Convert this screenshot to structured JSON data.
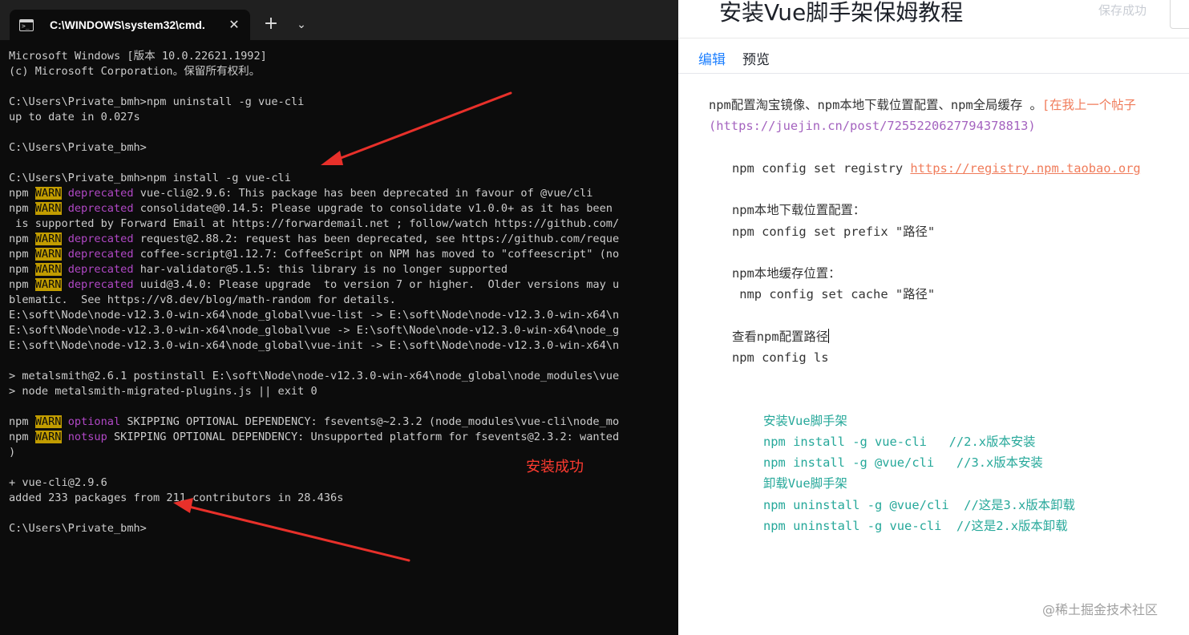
{
  "terminal": {
    "tab_title": "C:\\WINDOWS\\system32\\cmd.",
    "close_glyph": "✕",
    "new_tab_glyph": "+",
    "dropdown_glyph": "⌄",
    "lines": [
      [
        {
          "t": "Microsoft Windows [版本 10.0.22621.1992]"
        }
      ],
      [
        {
          "t": "(c) Microsoft Corporation。保留所有权利。"
        }
      ],
      [
        {
          "t": ""
        }
      ],
      [
        {
          "t": "C:\\Users\\Private_bmh>npm uninstall -g vue-cli"
        }
      ],
      [
        {
          "t": "up to date in 0.027s"
        }
      ],
      [
        {
          "t": ""
        }
      ],
      [
        {
          "t": "C:\\Users\\Private_bmh>"
        }
      ],
      [
        {
          "t": ""
        }
      ],
      [
        {
          "t": "C:\\Users\\Private_bmh>npm install -g vue-cli"
        }
      ],
      [
        {
          "t": "npm "
        },
        {
          "t": "WARN",
          "c": "w"
        },
        {
          "t": " "
        },
        {
          "t": "deprecated",
          "c": "k"
        },
        {
          "t": " vue-cli@2.9.6: This package has been deprecated in favour of @vue/cli"
        }
      ],
      [
        {
          "t": "npm "
        },
        {
          "t": "WARN",
          "c": "w"
        },
        {
          "t": " "
        },
        {
          "t": "deprecated",
          "c": "k"
        },
        {
          "t": " consolidate@0.14.5: Please upgrade to consolidate v1.0.0+ as it has been"
        }
      ],
      [
        {
          "t": " is supported by Forward Email at https://forwardemail.net ; follow/watch https://github.com/"
        }
      ],
      [
        {
          "t": "npm "
        },
        {
          "t": "WARN",
          "c": "w"
        },
        {
          "t": " "
        },
        {
          "t": "deprecated",
          "c": "k"
        },
        {
          "t": " request@2.88.2: request has been deprecated, see https://github.com/reque"
        }
      ],
      [
        {
          "t": "npm "
        },
        {
          "t": "WARN",
          "c": "w"
        },
        {
          "t": " "
        },
        {
          "t": "deprecated",
          "c": "k"
        },
        {
          "t": " coffee-script@1.12.7: CoffeeScript on NPM has moved to \"coffeescript\" (no"
        }
      ],
      [
        {
          "t": "npm "
        },
        {
          "t": "WARN",
          "c": "w"
        },
        {
          "t": " "
        },
        {
          "t": "deprecated",
          "c": "k"
        },
        {
          "t": " har-validator@5.1.5: this library is no longer supported"
        }
      ],
      [
        {
          "t": "npm "
        },
        {
          "t": "WARN",
          "c": "w"
        },
        {
          "t": " "
        },
        {
          "t": "deprecated",
          "c": "k"
        },
        {
          "t": " uuid@3.4.0: Please upgrade  to version 7 or higher.  Older versions may u"
        }
      ],
      [
        {
          "t": "blematic.  See https://v8.dev/blog/math-random for details."
        }
      ],
      [
        {
          "t": "E:\\soft\\Node\\node-v12.3.0-win-x64\\node_global\\vue-list -> E:\\soft\\Node\\node-v12.3.0-win-x64\\n"
        }
      ],
      [
        {
          "t": "E:\\soft\\Node\\node-v12.3.0-win-x64\\node_global\\vue -> E:\\soft\\Node\\node-v12.3.0-win-x64\\node_g"
        }
      ],
      [
        {
          "t": "E:\\soft\\Node\\node-v12.3.0-win-x64\\node_global\\vue-init -> E:\\soft\\Node\\node-v12.3.0-win-x64\\n"
        }
      ],
      [
        {
          "t": ""
        }
      ],
      [
        {
          "t": "> metalsmith@2.6.1 postinstall E:\\soft\\Node\\node-v12.3.0-win-x64\\node_global\\node_modules\\vue"
        }
      ],
      [
        {
          "t": "> node metalsmith-migrated-plugins.js || exit 0"
        }
      ],
      [
        {
          "t": ""
        }
      ],
      [
        {
          "t": "npm "
        },
        {
          "t": "WARN",
          "c": "w"
        },
        {
          "t": " "
        },
        {
          "t": "optional",
          "c": "k"
        },
        {
          "t": " SKIPPING OPTIONAL DEPENDENCY: fsevents@~2.3.2 (node_modules\\vue-cli\\node_mo"
        }
      ],
      [
        {
          "t": "npm "
        },
        {
          "t": "WARN",
          "c": "w"
        },
        {
          "t": " "
        },
        {
          "t": "notsup",
          "c": "k"
        },
        {
          "t": " SKIPPING OPTIONAL DEPENDENCY: Unsupported platform for fsevents@2.3.2: wanted"
        }
      ],
      [
        {
          "t": ")"
        }
      ],
      [
        {
          "t": ""
        }
      ],
      [
        {
          "t": "+ vue-cli@2.9.6"
        }
      ],
      [
        {
          "t": "added 233 packages from 211 contributors in 28.436s"
        }
      ],
      [
        {
          "t": ""
        }
      ],
      [
        {
          "t": "C:\\Users\\Private_bmh>"
        }
      ]
    ]
  },
  "annotation": {
    "success_label": "安装成功",
    "arrow_color": "#e8302a"
  },
  "editor": {
    "title": "安装Vue脚手架保姆教程",
    "save_status": "保存成功",
    "tabs": {
      "edit": "编辑",
      "preview": "预览"
    },
    "accent_color": "#1e80ff",
    "content": {
      "intro_text": "npm配置淘宝镜像、npm本地下载位置配置、npm全局缓存 。",
      "intro_link_text": "[在我上一个帖子",
      "intro_url": "(https://juejin.cn/post/7255220627794378813)",
      "registry_cmd": "npm config set registry ",
      "registry_url": "https://registry.npm.taobao.org",
      "prefix_heading": "npm本地下载位置配置：",
      "prefix_cmd": "npm config set prefix \"路径\"",
      "cache_heading": "npm本地缓存位置：",
      "cache_cmd": " nmp config set cache \"路径\"",
      "view_heading": "查看npm配置路径",
      "view_cmd": "npm config ls",
      "code_lines": [
        "安装Vue脚手架",
        "npm install -g vue-cli   //2.x版本安装",
        "npm install -g @vue/cli   //3.x版本安装",
        "卸载Vue脚手架",
        "npm uninstall -g @vue/cli  //这是3.x版本卸载",
        "npm uninstall -g vue-cli  //这是2.x版本卸载"
      ]
    }
  },
  "watermark": "@稀土掘金技术社区"
}
